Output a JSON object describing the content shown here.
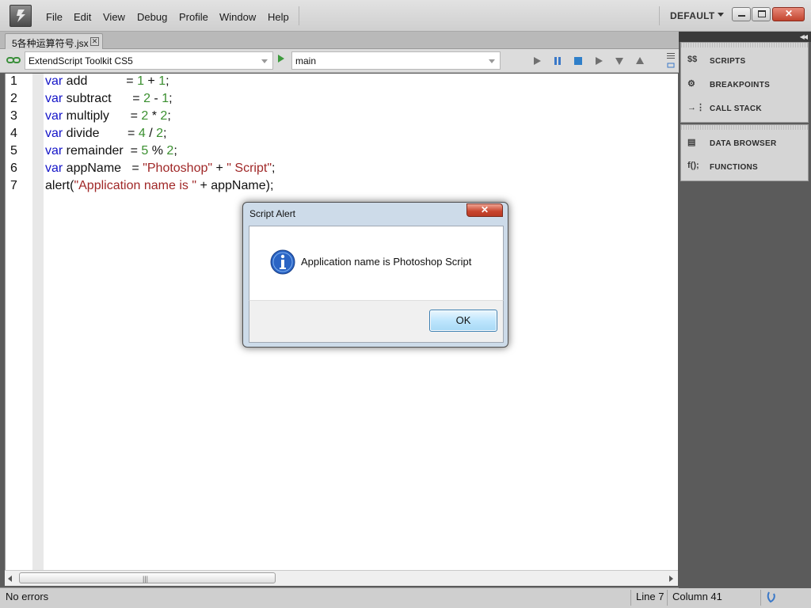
{
  "menu": {
    "items": [
      "File",
      "Edit",
      "View",
      "Debug",
      "Profile",
      "Window",
      "Help"
    ]
  },
  "workspace": {
    "label": "DEFAULT"
  },
  "document_tab": {
    "label": "5各种运算符号.jsx",
    "close_glyph": "✕"
  },
  "toolbar": {
    "target_app": "ExtendScript Toolkit CS5",
    "engine": "main"
  },
  "editor": {
    "line_numbers": [
      "1",
      "2",
      "3",
      "4",
      "5",
      "6",
      "7"
    ],
    "lines": [
      [
        {
          "t": "var",
          "c": "kw"
        },
        {
          "t": " add           = ",
          "c": ""
        },
        {
          "t": "1",
          "c": "num"
        },
        {
          "t": " + ",
          "c": ""
        },
        {
          "t": "1",
          "c": "num"
        },
        {
          "t": ";",
          "c": ""
        }
      ],
      [
        {
          "t": "var",
          "c": "kw"
        },
        {
          "t": " subtract      = ",
          "c": ""
        },
        {
          "t": "2",
          "c": "num"
        },
        {
          "t": " - ",
          "c": ""
        },
        {
          "t": "1",
          "c": "num"
        },
        {
          "t": ";",
          "c": ""
        }
      ],
      [
        {
          "t": "var",
          "c": "kw"
        },
        {
          "t": " multiply      = ",
          "c": ""
        },
        {
          "t": "2",
          "c": "num"
        },
        {
          "t": " * ",
          "c": ""
        },
        {
          "t": "2",
          "c": "num"
        },
        {
          "t": ";",
          "c": ""
        }
      ],
      [
        {
          "t": "var",
          "c": "kw"
        },
        {
          "t": " divide        = ",
          "c": ""
        },
        {
          "t": "4",
          "c": "num"
        },
        {
          "t": " / ",
          "c": ""
        },
        {
          "t": "2",
          "c": "num"
        },
        {
          "t": ";",
          "c": ""
        }
      ],
      [
        {
          "t": "var",
          "c": "kw"
        },
        {
          "t": " remainder  = ",
          "c": ""
        },
        {
          "t": "5",
          "c": "num"
        },
        {
          "t": " % ",
          "c": ""
        },
        {
          "t": "2",
          "c": "num"
        },
        {
          "t": ";",
          "c": ""
        }
      ],
      [
        {
          "t": "var",
          "c": "kw"
        },
        {
          "t": " appName   = ",
          "c": ""
        },
        {
          "t": "\"Photoshop\"",
          "c": "str"
        },
        {
          "t": " + ",
          "c": ""
        },
        {
          "t": "\" Script\"",
          "c": "str"
        },
        {
          "t": ";",
          "c": ""
        }
      ],
      [
        {
          "t": "alert(",
          "c": ""
        },
        {
          "t": "\"Application name is \"",
          "c": "str"
        },
        {
          "t": " + appName);",
          "c": ""
        }
      ]
    ]
  },
  "panel": {
    "group1": [
      {
        "label": "SCRIPTS",
        "icon": "scripts-icon",
        "glyph": "$$"
      },
      {
        "label": "BREAKPOINTS",
        "icon": "breakpoints-icon",
        "glyph": "⚙"
      },
      {
        "label": "CALL STACK",
        "icon": "call-stack-icon",
        "glyph": "→⋮"
      }
    ],
    "group2": [
      {
        "label": "DATA BROWSER",
        "icon": "data-browser-icon",
        "glyph": "▤"
      },
      {
        "label": "FUNCTIONS",
        "icon": "functions-icon",
        "glyph": "f();"
      }
    ]
  },
  "dialog": {
    "title": "Script Alert",
    "message": "Application name is Photoshop Script",
    "ok_label": "OK"
  },
  "statusbar": {
    "message": "No errors",
    "line": "Line 7",
    "column": "Column 41"
  },
  "colors": {
    "keyword": "#1515c8",
    "number": "#3a8f2f",
    "string": "#a02828"
  }
}
